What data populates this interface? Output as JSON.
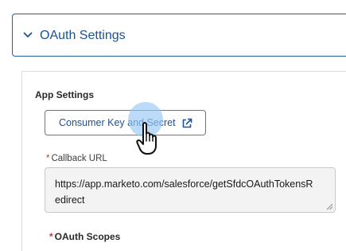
{
  "oauth_section": {
    "title": "OAuth Settings",
    "expand_icon": "chevron-down-icon"
  },
  "app_settings": {
    "title": "App Settings",
    "consumer_button": {
      "label": "Consumer Key and Secret",
      "icon": "external-link-icon"
    },
    "callback_url": {
      "required_marker": "*",
      "label": "Callback URL",
      "line1": "https://app.marketo.com/salesforce/getSfdcOAuthTokensR",
      "line2": "edirect"
    },
    "oauth_scopes": {
      "required_marker": "*",
      "label": "OAuth Scopes"
    }
  },
  "colors": {
    "accent": "#1b5297",
    "border_focus": "#1f5fa8",
    "required": "#c23934",
    "click_highlight": "#96c8f5"
  }
}
